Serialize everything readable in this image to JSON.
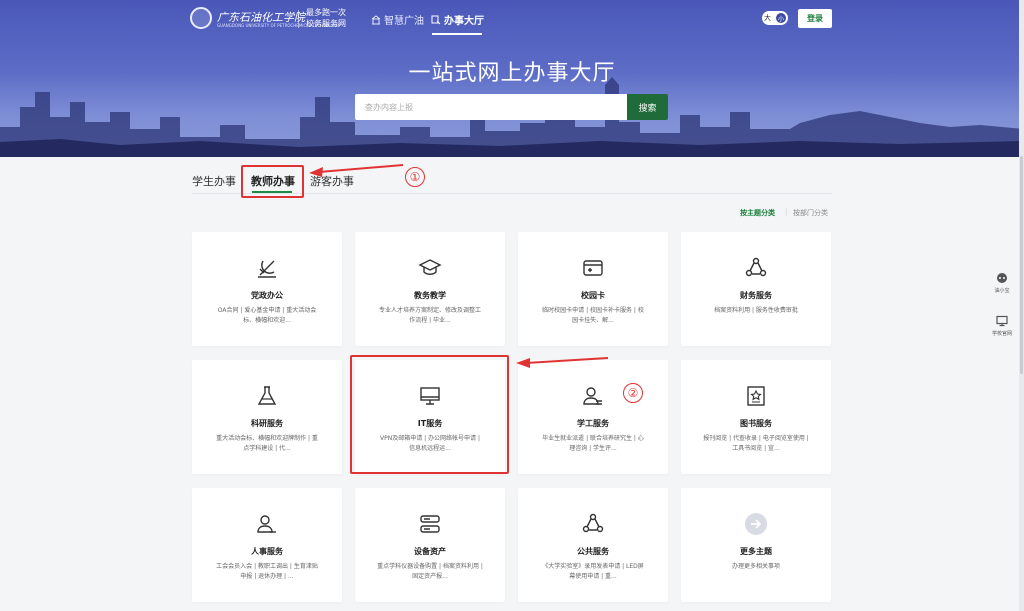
{
  "header": {
    "logo_text": "广东石油化工学院",
    "logo_subtext": "GUANGDONG UNIVERSITY OF PETROCHEMICAL TECHNOLOGY",
    "slogan_line1": "最多跑一次",
    "slogan_line2": "校务服务网",
    "nav": [
      {
        "label": "智慧广油",
        "icon": "building-icon"
      },
      {
        "label": "办事大厅",
        "icon": "hall-icon",
        "active": true
      }
    ],
    "lang_label": "大",
    "lang_knob": "小",
    "login_label": "登录"
  },
  "hero": {
    "title": "一站式网上办事大厅",
    "search_placeholder": "查办内容上报",
    "search_button": "搜索"
  },
  "tabs": [
    {
      "label": "学生办事"
    },
    {
      "label": "教师办事",
      "active": true
    },
    {
      "label": "游客办事"
    }
  ],
  "annotations": {
    "first": "①",
    "second": "②"
  },
  "classify": {
    "active": "按主题分类",
    "separator": "|",
    "other": "按部门分类"
  },
  "cards": [
    {
      "title": "党政办公",
      "desc": "OA合同 | 爱心基金申请 | 重大活动会标、横幅和欢迎...",
      "icon": "party-icon"
    },
    {
      "title": "教务教学",
      "desc": "专业人才培养方案制定、修改及调整工作流程 | 毕业...",
      "icon": "graduation-cap-icon"
    },
    {
      "title": "校园卡",
      "desc": "临时校园卡申请 | 校园卡补卡服务 | 校园卡挂失、解...",
      "icon": "card-icon"
    },
    {
      "title": "财务服务",
      "desc": "档案资料利用 | 服务性收费审批",
      "icon": "finance-icon"
    },
    {
      "title": "科研服务",
      "desc": "重大活动会标、横幅和欢迎牌制作 | 重点学科建设 | 代...",
      "icon": "flask-icon"
    },
    {
      "title": "IT服务",
      "desc": "VPN及邮箱申请 | 办公网络帐号申请 | 信息机远程运...",
      "icon": "monitor-icon"
    },
    {
      "title": "学工服务",
      "desc": "毕业生就业派遣 | 联合培养研究生 | 心理咨询 | 学生评...",
      "icon": "student-icon"
    },
    {
      "title": "图书服务",
      "desc": "报刊阅览 | 代查收录 | 电子阅览室使用 | 工具书阅览 | 宣...",
      "icon": "book-icon"
    },
    {
      "title": "人事服务",
      "desc": "工会会员入会 | 教职工调出 | 生育津贴申报 | 退休办理 | ...",
      "icon": "user-edit-icon"
    },
    {
      "title": "设备资产",
      "desc": "重点学科仪器设备购置 | 档案资料利用 | 固定资产报...",
      "icon": "server-icon"
    },
    {
      "title": "公共服务",
      "desc": "《大学实验室》录用发表申请 | LED屏幕使用申请 | 重...",
      "icon": "network-icon"
    },
    {
      "title": "更多主题",
      "desc": "办理更多相关事项",
      "icon": "arrow-right-circle-icon"
    }
  ],
  "side": [
    {
      "label": "油小宝",
      "icon": "robot-icon"
    },
    {
      "label": "学校官网",
      "icon": "desktop-icon"
    }
  ]
}
